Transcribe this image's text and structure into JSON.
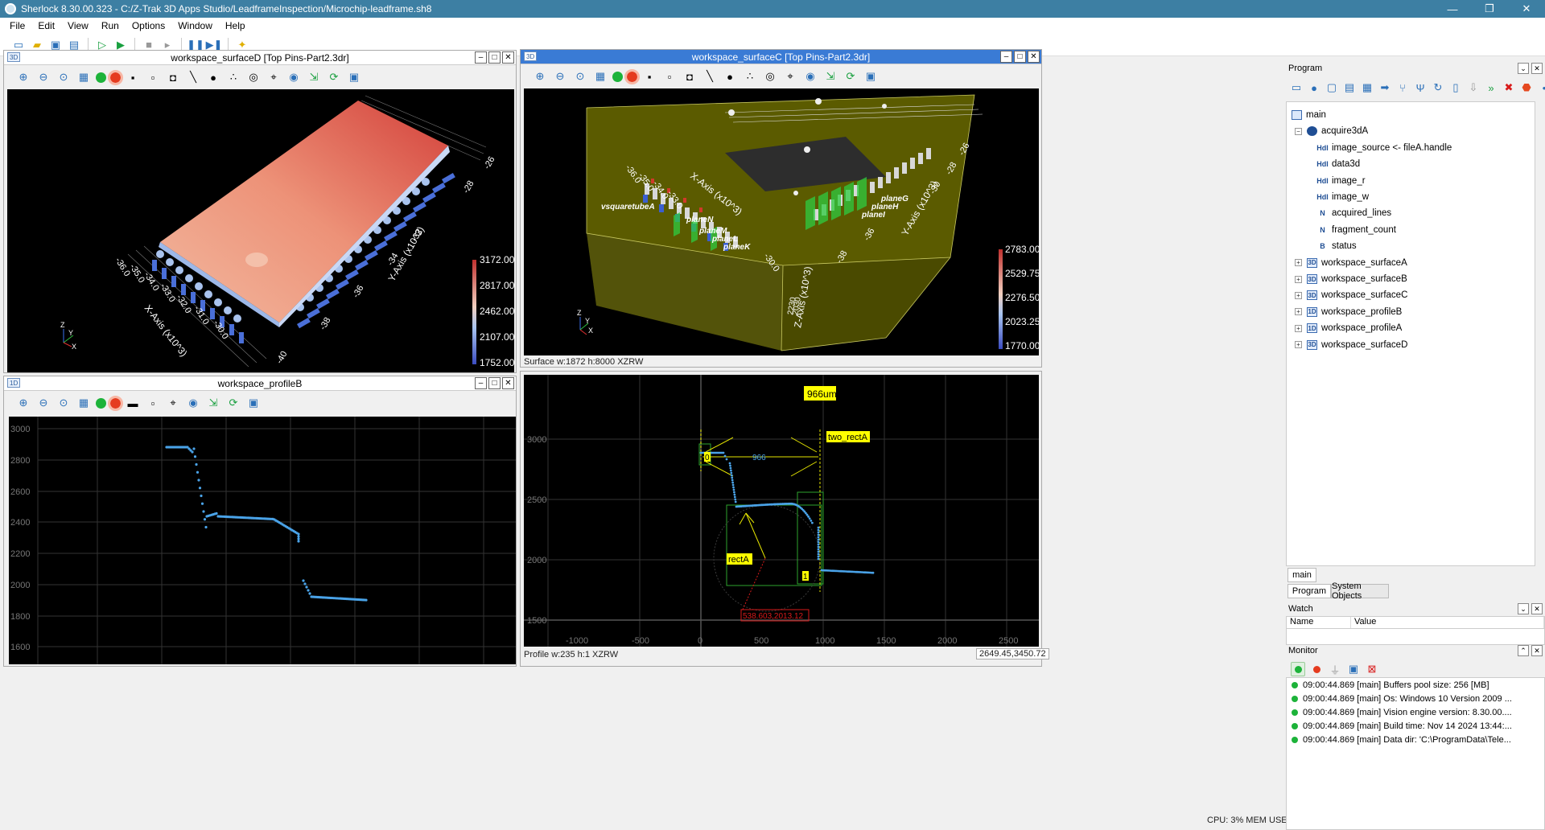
{
  "app": {
    "title": "Sherlock 8.30.00.323 - C:/Z-Trak 3D Apps Studio/LeadframeInspection/Microchip-leadframe.sh8",
    "minimize": "—",
    "maximize": "❐",
    "close": "✕"
  },
  "menu": [
    "File",
    "Edit",
    "View",
    "Run",
    "Options",
    "Window",
    "Help"
  ],
  "panels": {
    "surfaceD": {
      "title": "workspace_surfaceD [Top Pins-Part2.3dr]",
      "badge": "3D",
      "colorbar": [
        "3172.00",
        "2817.00",
        "2462.00",
        "2107.00",
        "1752.00"
      ],
      "x_ticks": [
        "-36.0",
        "-35.0",
        "-34.0",
        "-33.0",
        "-32.0",
        "-31.0",
        "-30.0"
      ],
      "x_axis": "X-Axis (x10^3)",
      "y_ticks": [
        "-26",
        "-28",
        "-30",
        "-32",
        "-34",
        "-36",
        "-38",
        "-40"
      ],
      "y_axis": "Y-Axis (x10^3)",
      "axis_labels": [
        "Y",
        "Z",
        "X"
      ]
    },
    "surfaceC": {
      "title": "workspace_surfaceC [Top Pins-Part2.3dr]",
      "badge": "3D",
      "colorbar": [
        "2783.00",
        "2529.75",
        "2276.50",
        "2023.25",
        "1770.00"
      ],
      "x_axis": "X-Axis (x10^3)",
      "y_axis": "Y-Axis (x10^3)",
      "z_axis": "Z-Axis (x10^3)",
      "x_ticks": [
        "-36.0",
        "-35.0",
        "-34.0",
        "-33.0",
        "-32.0",
        "-31.0",
        "-30.0"
      ],
      "y_ticks": [
        "-26",
        "-28",
        "-30",
        "-32",
        "-34",
        "-36",
        "-38"
      ],
      "z_ticks": [
        "2230",
        "2030",
        "1830"
      ],
      "labels": [
        "vsquaretubeA",
        "planeN",
        "planeM",
        "planeL",
        "planeK",
        "planeG",
        "planeH",
        "planeI"
      ],
      "status": "Surface w:1872 h:8000 XZRW"
    },
    "profileB": {
      "title": "workspace_profileB",
      "badge": "1D",
      "y_ticks": [
        "3000",
        "2800",
        "2600",
        "2400",
        "2200",
        "2000",
        "1800",
        "1600"
      ]
    },
    "profileView": {
      "measure_label": "966um",
      "rect_label": "two_rectA",
      "dist_label": "966",
      "rect_a": "rectA",
      "coord_label": "538.603,2013.12",
      "marker0": "0",
      "marker1": "1",
      "y_ticks": [
        "3000",
        "2500",
        "2000",
        "1500"
      ],
      "x_ticks": [
        "-1000",
        "-500",
        "0",
        "500",
        "1000",
        "1500",
        "2000",
        "2500"
      ],
      "status": "Profile w:235 h:1 XZRW",
      "cursor": "2649.45,3450.72"
    }
  },
  "program": {
    "header": "Program",
    "tree": [
      {
        "label": "main",
        "depth": 0,
        "icon": "main"
      },
      {
        "label": "acquire3dA",
        "depth": 1,
        "icon": "op",
        "exp": "−"
      },
      {
        "label": "image_source <- fileA.handle",
        "depth": 2,
        "icon": "Hdl"
      },
      {
        "label": "data3d",
        "depth": 2,
        "icon": "Hdl"
      },
      {
        "label": "image_r",
        "depth": 2,
        "icon": "Hdl"
      },
      {
        "label": "image_w",
        "depth": 2,
        "icon": "Hdl"
      },
      {
        "label": "acquired_lines",
        "depth": 2,
        "icon": "N"
      },
      {
        "label": "fragment_count",
        "depth": 2,
        "icon": "N"
      },
      {
        "label": "status",
        "depth": 2,
        "icon": "B"
      },
      {
        "label": "workspace_surfaceA",
        "depth": 1,
        "icon": "3D",
        "exp": "+"
      },
      {
        "label": "workspace_surfaceB",
        "depth": 1,
        "icon": "3D",
        "exp": "+"
      },
      {
        "label": "workspace_surfaceC",
        "depth": 1,
        "icon": "3D",
        "exp": "+"
      },
      {
        "label": "workspace_profileB",
        "depth": 1,
        "icon": "1D",
        "exp": "+"
      },
      {
        "label": "workspace_profileA",
        "depth": 1,
        "icon": "1D",
        "exp": "+"
      },
      {
        "label": "workspace_surfaceD",
        "depth": 1,
        "icon": "3D",
        "exp": "+"
      }
    ],
    "tab_main": "main",
    "tab_program": "Program",
    "tab_system": "System Objects"
  },
  "watch": {
    "header": "Watch",
    "col_name": "Name",
    "col_value": "Value"
  },
  "monitor": {
    "header": "Monitor",
    "lines": [
      "09:00:44.869 [main] Buffers pool size: 256 [MB]",
      "09:00:44.869 [main] Os: Windows 10 Version 2009 ...",
      "09:00:44.869 [main] Vision engine version: 8.30.00....",
      "09:00:44.869 [main] Build time: Nov 14 2024 13:44:...",
      "09:00:44.869 [main] Data dir: 'C:\\ProgramData\\Tele..."
    ]
  },
  "status_bar": {
    "cpu": "CPU: 3% MEM USE"
  },
  "colors": {
    "titlebar": "#3d7fa3",
    "active_panel": "#3a7bd5",
    "profile_points": "#4aa3e8",
    "label_yellow": "#ffff00"
  }
}
